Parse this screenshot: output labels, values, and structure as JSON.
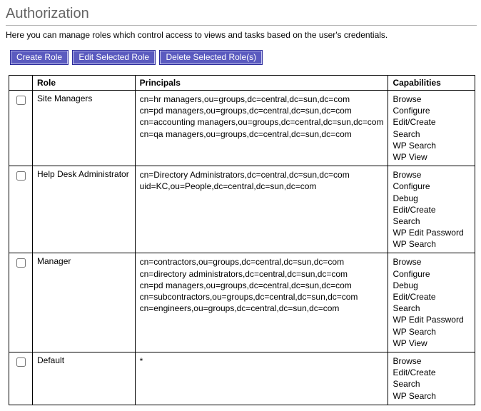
{
  "header": {
    "title": "Authorization",
    "description": "Here you can manage roles which control access to views and tasks based on the user's credentials."
  },
  "toolbar": {
    "create_label": "Create Role",
    "edit_label": "Edit Selected Role",
    "delete_label": "Delete Selected Role(s)"
  },
  "table": {
    "columns": {
      "role": "Role",
      "principals": "Principals",
      "capabilities": "Capabilities"
    },
    "rows": [
      {
        "role": "Site Managers",
        "principals": [
          "cn=hr managers,ou=groups,dc=central,dc=sun,dc=com",
          "cn=pd managers,ou=groups,dc=central,dc=sun,dc=com",
          "cn=accounting managers,ou=groups,dc=central,dc=sun,dc=com",
          "cn=qa managers,ou=groups,dc=central,dc=sun,dc=com"
        ],
        "capabilities": [
          "Browse",
          "Configure",
          "Edit/Create",
          "Search",
          "WP Search",
          "WP View"
        ]
      },
      {
        "role": "Help Desk Administrator",
        "principals": [
          "cn=Directory Administrators,dc=central,dc=sun,dc=com",
          "uid=KC,ou=People,dc=central,dc=sun,dc=com"
        ],
        "capabilities": [
          "Browse",
          "Configure",
          "Debug",
          "Edit/Create",
          "Search",
          "WP Edit Password",
          "WP Search"
        ]
      },
      {
        "role": "Manager",
        "principals": [
          "cn=contractors,ou=groups,dc=central,dc=sun,dc=com",
          "cn=directory administrators,dc=central,dc=sun,dc=com",
          "cn=pd managers,ou=groups,dc=central,dc=sun,dc=com",
          "cn=subcontractors,ou=groups,dc=central,dc=sun,dc=com",
          "cn=engineers,ou=groups,dc=central,dc=sun,dc=com"
        ],
        "capabilities": [
          "Browse",
          "Configure",
          "Debug",
          "Edit/Create",
          "Search",
          "WP Edit Password",
          "WP Search",
          "WP View"
        ]
      },
      {
        "role": "Default",
        "principals": [
          "*"
        ],
        "capabilities": [
          "Browse",
          "Edit/Create",
          "Search",
          "WP Search"
        ]
      }
    ]
  }
}
